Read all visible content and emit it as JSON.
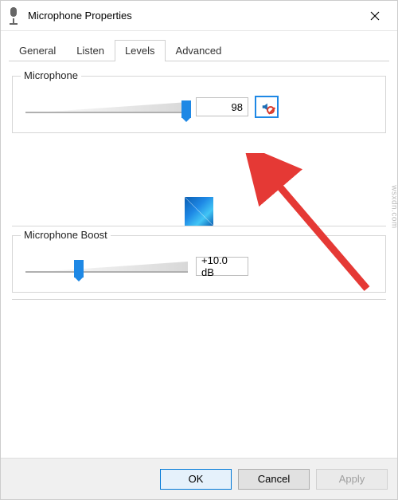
{
  "window": {
    "title": "Microphone Properties"
  },
  "tabs": [
    {
      "label": "General",
      "active": false
    },
    {
      "label": "Listen",
      "active": false
    },
    {
      "label": "Levels",
      "active": true
    },
    {
      "label": "Advanced",
      "active": false
    }
  ],
  "levels": {
    "microphone": {
      "legend": "Microphone",
      "value": "98",
      "slider_percent": 98,
      "muted": true
    },
    "boost": {
      "legend": "Microphone Boost",
      "value": "+10.0 dB",
      "slider_percent": 33
    }
  },
  "buttons": {
    "ok": "OK",
    "cancel": "Cancel",
    "apply": "Apply"
  },
  "watermark": "wsxdn.com"
}
